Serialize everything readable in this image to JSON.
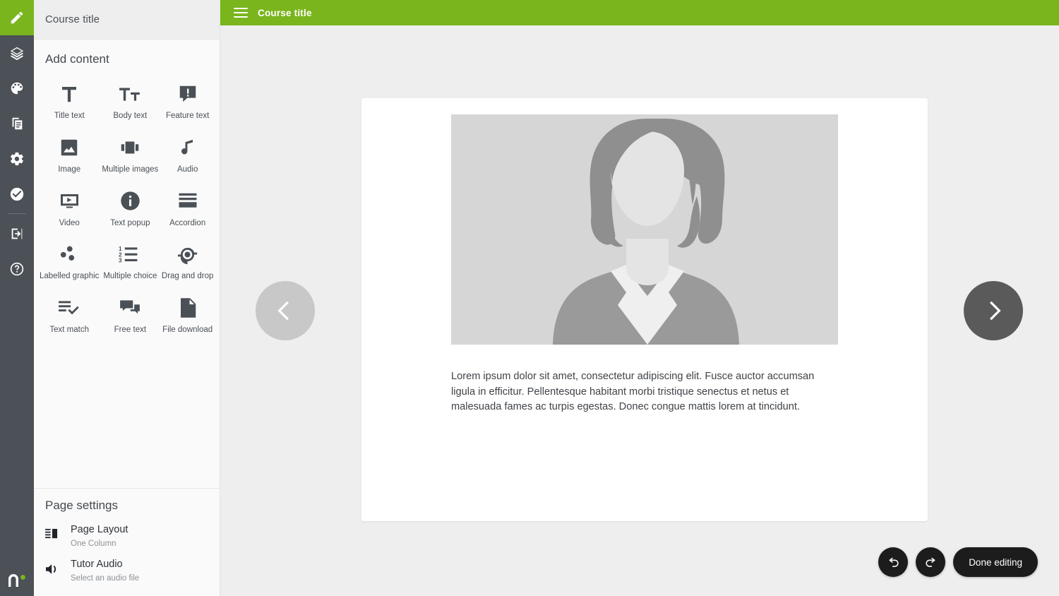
{
  "rail": {
    "items": [
      {
        "name": "edit",
        "icon": "pencil-icon",
        "active": true
      },
      {
        "name": "layers",
        "icon": "layers-icon",
        "active": false
      },
      {
        "name": "theme",
        "icon": "palette-icon",
        "active": false
      },
      {
        "name": "pages",
        "icon": "pages-icon",
        "active": false
      },
      {
        "name": "settings",
        "icon": "gear-icon",
        "active": false
      },
      {
        "name": "review",
        "icon": "check-circle-icon",
        "active": false
      },
      {
        "name": "publish",
        "icon": "export-icon",
        "active": false
      },
      {
        "name": "help",
        "icon": "help-circle-icon",
        "active": false
      }
    ],
    "logo_alt": "n-logo"
  },
  "panel": {
    "header_title": "Course title",
    "section_title": "Add content",
    "content_types": [
      {
        "label": "Title text",
        "icon": "title-text-icon"
      },
      {
        "label": "Body text",
        "icon": "body-text-icon"
      },
      {
        "label": "Feature text",
        "icon": "feature-text-icon"
      },
      {
        "label": "Image",
        "icon": "image-icon"
      },
      {
        "label": "Multiple images",
        "icon": "multiple-images-icon"
      },
      {
        "label": "Audio",
        "icon": "audio-note-icon"
      },
      {
        "label": "Video",
        "icon": "video-icon"
      },
      {
        "label": "Text popup",
        "icon": "info-circle-icon"
      },
      {
        "label": "Accordion",
        "icon": "accordion-icon"
      },
      {
        "label": "Labelled graphic",
        "icon": "labelled-graphic-icon"
      },
      {
        "label": "Multiple choice",
        "icon": "numbered-list-icon"
      },
      {
        "label": "Drag and drop",
        "icon": "target-icon"
      },
      {
        "label": "Text match",
        "icon": "text-match-icon"
      },
      {
        "label": "Free text",
        "icon": "speech-bubbles-icon"
      },
      {
        "label": "File download",
        "icon": "file-icon"
      }
    ],
    "page_settings": {
      "title": "Page settings",
      "rows": [
        {
          "label": "Page Layout",
          "value": "One Column",
          "icon": "layout-columns-icon"
        },
        {
          "label": "Tutor Audio",
          "value": "Select an audio file",
          "icon": "speaker-icon"
        }
      ]
    }
  },
  "topbar": {
    "menu_icon": "hamburger-icon",
    "title": "Course title"
  },
  "slide": {
    "image_alt": "person-silhouette-placeholder",
    "body_text": "Lorem ipsum dolor sit amet, consectetur adipiscing elit. Fusce auctor accumsan ligula in efficitur. Pellentesque habitant morbi tristique senectus et netus et malesuada fames ac turpis egestas. Donec congue mattis lorem at tincidunt.",
    "prev_label": "Previous page",
    "next_label": "Next page"
  },
  "controls": {
    "undo_label": "Undo",
    "redo_label": "Redo",
    "done_label": "Done editing"
  },
  "colors": {
    "brand_green": "#7ab51d",
    "rail_dark": "#4b5157",
    "canvas_bg": "#eeeeee",
    "panel_bg": "#fafafa",
    "button_dark": "#1c1c1c",
    "nav_prev": "#c8c8c8",
    "nav_next": "#5a5a5a"
  }
}
